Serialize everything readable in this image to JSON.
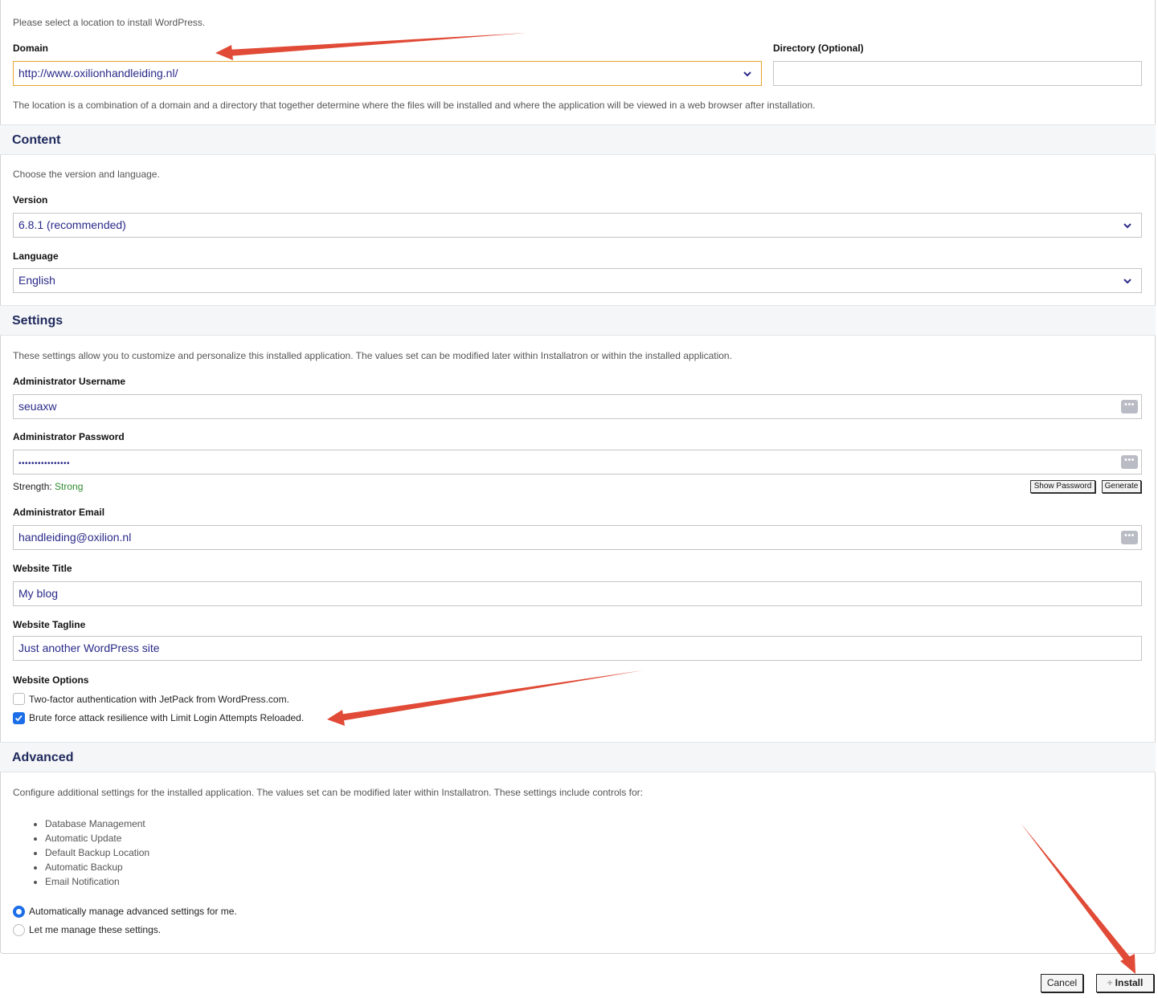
{
  "location": {
    "intro": "Please select a location to install WordPress.",
    "domain_label": "Domain",
    "domain_value": "http://www.oxilionhandleiding.nl/",
    "directory_label": "Directory (Optional)",
    "directory_value": "",
    "help": "The location is a combination of a domain and a directory that together determine where the files will be installed and where the application will be viewed in a web browser after installation."
  },
  "content": {
    "title": "Content",
    "intro": "Choose the version and language.",
    "version_label": "Version",
    "version_value": "6.8.1 (recommended)",
    "language_label": "Language",
    "language_value": "English"
  },
  "settings": {
    "title": "Settings",
    "intro": "These settings allow you to customize and personalize this installed application. The values set can be modified later within Installatron or within the installed application.",
    "username_label": "Administrator Username",
    "username_value": "seuaxw",
    "password_label": "Administrator Password",
    "password_value": "••••••••••••••••",
    "strength_label": "Strength:",
    "strength_value": "Strong",
    "show_password": "Show Password",
    "generate": "Generate",
    "email_label": "Administrator Email",
    "email_value": "handleiding@oxilion.nl",
    "title_label": "Website Title",
    "title_value": "My blog",
    "tagline_label": "Website Tagline",
    "tagline_value": "Just another WordPress site",
    "options_label": "Website Options",
    "options": [
      {
        "label": "Two-factor authentication with JetPack from WordPress.com.",
        "checked": false
      },
      {
        "label": "Brute force attack resilience with Limit Login Attempts Reloaded.",
        "checked": true
      }
    ]
  },
  "advanced": {
    "title": "Advanced",
    "intro": "Configure additional settings for the installed application. The values set can be modified later within Installatron. These settings include controls for:",
    "items": [
      "Database Management",
      "Automatic Update",
      "Default Backup Location",
      "Automatic Backup",
      "Email Notification"
    ],
    "radio_auto": "Automatically manage advanced settings for me.",
    "radio_manual": "Let me manage these settings.",
    "selected": "auto"
  },
  "footer": {
    "cancel": "Cancel",
    "install": "Install"
  },
  "colors": {
    "accent": "#1c6ee8",
    "heading": "#1f2a5c",
    "field_text": "#2a2a8a",
    "strength": "#2e8b2e",
    "annotation_arrow": "#e04a36",
    "focus_border": "#e6a32a"
  }
}
